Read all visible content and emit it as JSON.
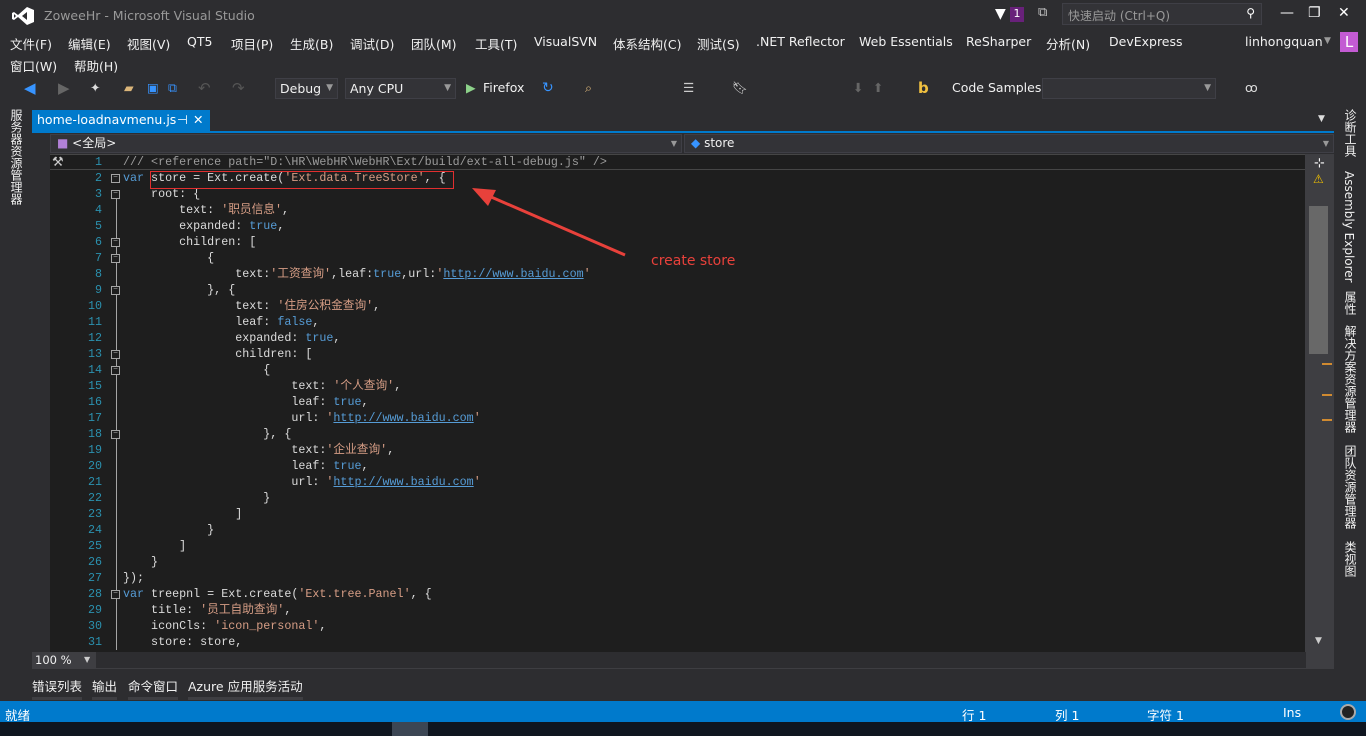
{
  "window": {
    "title": "ZoweeHr - Microsoft Visual Studio",
    "logo": "visual-studio-logo",
    "notifications": "1",
    "quick_launch_placeholder": "快速启动 (Ctrl+Q)",
    "user": "linhongquan",
    "avatar_letter": "L",
    "accent": "#007acc"
  },
  "menu": [
    "文件(F)",
    "编辑(E)",
    "视图(V)",
    "QT5",
    "项目(P)",
    "生成(B)",
    "调试(D)",
    "团队(M)",
    "工具(T)",
    "VisualSVN",
    "体系结构(C)",
    "测试(S)",
    ".NET Reflector",
    "Web Essentials",
    "ReSharper",
    "分析(N)",
    "DevExpress"
  ],
  "menu2": [
    "窗口(W)",
    "帮助(H)"
  ],
  "toolbar": {
    "config": "Debug",
    "platform": "Any CPU",
    "run_target": "Firefox",
    "code_samples": "Code Samples",
    "code_samples_value": ""
  },
  "left_tabs": [
    "服务器资源管理器"
  ],
  "right_tabs": [
    "诊断工具",
    "Assembly Explorer",
    "属性",
    "解决方案资源管理器",
    "团队资源管理器",
    "类视图"
  ],
  "document_tab": {
    "label": "home-loadnavmenu.js",
    "pin": "⊣",
    "close": "✕"
  },
  "navbar": {
    "scope": "<全局>",
    "member": "store"
  },
  "code_lines": [
    "/// <reference path=\"D:\\HR\\WebHR\\WebHR\\Ext/build/ext-all-debug.js\" />",
    "var store = Ext.create('Ext.data.TreeStore', {",
    "    root: {",
    "        text: '职员信息',",
    "        expanded: true,",
    "        children: [",
    "            {",
    "                text:'工资查询',leaf:true,url:'http://www.baidu.com'",
    "            }, {",
    "                text: '住房公积金查询',",
    "                leaf: false,",
    "                expanded: true,",
    "                children: [",
    "                    {",
    "                        text: '个人查询',",
    "                        leaf: true,",
    "                        url: 'http://www.baidu.com'",
    "                    }, {",
    "                        text:'企业查询',",
    "                        leaf: true,",
    "                        url: 'http://www.baidu.com'",
    "                    }",
    "                ]",
    "            }",
    "        ]",
    "    }",
    "});",
    "var treepnl = Ext.create('Ext.tree.Panel', {",
    "    title: '员工自助查询',",
    "    iconCls: 'icon_personal',",
    "    store: store,"
  ],
  "fold_lines": [
    2,
    3,
    6,
    7,
    9,
    13,
    14,
    18,
    28
  ],
  "annotation": "create store",
  "zoom": "100 %",
  "bottom_tabs": [
    "错误列表",
    "输出",
    "命令窗口",
    "Azure 应用服务活动"
  ],
  "status": {
    "ready": "就绪",
    "line": "行 1",
    "col": "列 1",
    "char": "字符 1",
    "mode": "Ins"
  }
}
